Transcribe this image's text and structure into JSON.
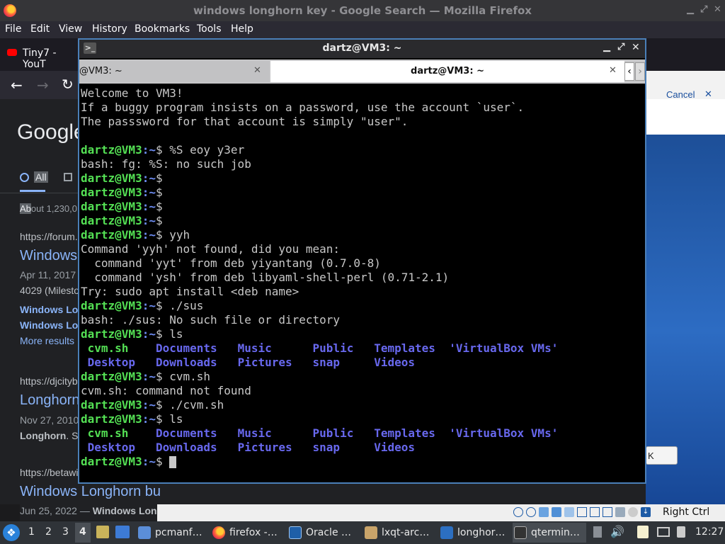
{
  "firefox": {
    "window_title": "windows longhorn key - Google Search — Mozilla Firefox",
    "menu": [
      "File",
      "Edit",
      "View",
      "History",
      "Bookmarks",
      "Tools",
      "Help"
    ],
    "tab_label": "Tiny7 - YouT",
    "google": {
      "logo": "Google",
      "tab_all": "All",
      "about_prefix": "Ab",
      "about_rest": "out 1,230,0",
      "results": [
        {
          "url": "https://forum.",
          "title": "Windows",
          "date": "Apr 11, 2017",
          "snippet": "4029 (Milesto",
          "sub1": "Windows Lo",
          "sub2": "Windows Lo",
          "more": "More results"
        },
        {
          "url": "https://djcityb",
          "title": "Longhorn",
          "date": "Nov 27, 2010",
          "snippet_bold": "Longhorn",
          "snippet": ". S"
        },
        {
          "url": "https://betawi",
          "title": "Windows Longhorn bu",
          "date": "Jun 25, 2022 —",
          "snippet_bold": "Windows Lon"
        }
      ],
      "cancel": "Cancel",
      "ok_frag": "K"
    }
  },
  "terminal": {
    "title": "dartz@VM3: ~",
    "tabs": [
      {
        "label": "@VM3: ~",
        "active": false
      },
      {
        "label": "dartz@VM3: ~",
        "active": true
      }
    ],
    "prompt_user": "dartz@VM3",
    "prompt_path": ":~",
    "prompt_sym": "$",
    "lines": [
      {
        "type": "text",
        "text": "Welcome to VM3!"
      },
      {
        "type": "text",
        "text": "If a buggy program insists on a password, use the account `user`."
      },
      {
        "type": "text",
        "text": "The passsword for that account is simply \"user\"."
      },
      {
        "type": "text",
        "text": ""
      },
      {
        "type": "prompt",
        "cmd": " %S eoy y3er"
      },
      {
        "type": "text",
        "text": "bash: fg: %S: no such job"
      },
      {
        "type": "prompt",
        "cmd": ""
      },
      {
        "type": "prompt",
        "cmd": ""
      },
      {
        "type": "prompt",
        "cmd": ""
      },
      {
        "type": "prompt",
        "cmd": ""
      },
      {
        "type": "prompt",
        "cmd": " yyh"
      },
      {
        "type": "text",
        "text": "Command 'yyh' not found, did you mean:"
      },
      {
        "type": "text",
        "text": "  command 'yyt' from deb yiyantang (0.7.0-8)"
      },
      {
        "type": "text",
        "text": "  command 'ysh' from deb libyaml-shell-perl (0.71-2.1)"
      },
      {
        "type": "text",
        "text": "Try: sudo apt install <deb name>"
      },
      {
        "type": "prompt",
        "cmd": " ./sus"
      },
      {
        "type": "text",
        "text": "bash: ./sus: No such file or directory"
      },
      {
        "type": "prompt",
        "cmd": " ls"
      },
      {
        "type": "ls",
        "items": [
          {
            "t": " cvm.sh    ",
            "c": "exe"
          },
          {
            "t": "Documents   ",
            "c": "dirc"
          },
          {
            "t": "Music      ",
            "c": "dirc"
          },
          {
            "t": "Public   ",
            "c": "dirc"
          },
          {
            "t": "Templates  ",
            "c": "dirc"
          },
          {
            "t": "'VirtualBox VMs'",
            "c": "dirc"
          }
        ]
      },
      {
        "type": "ls",
        "items": [
          {
            "t": " Desktop   ",
            "c": "dirc"
          },
          {
            "t": "Downloads   ",
            "c": "dirc"
          },
          {
            "t": "Pictures   ",
            "c": "dirc"
          },
          {
            "t": "snap     ",
            "c": "dirc"
          },
          {
            "t": "Videos",
            "c": "dirc"
          }
        ]
      },
      {
        "type": "prompt",
        "cmd": " cvm.sh"
      },
      {
        "type": "text",
        "text": "cvm.sh: command not found"
      },
      {
        "type": "prompt",
        "cmd": " ./cvm.sh"
      },
      {
        "type": "prompt",
        "cmd": " ls"
      },
      {
        "type": "ls",
        "items": [
          {
            "t": " cvm.sh    ",
            "c": "exe"
          },
          {
            "t": "Documents   ",
            "c": "dirc"
          },
          {
            "t": "Music      ",
            "c": "dirc"
          },
          {
            "t": "Public   ",
            "c": "dirc"
          },
          {
            "t": "Templates  ",
            "c": "dirc"
          },
          {
            "t": "'VirtualBox VMs'",
            "c": "dirc"
          }
        ]
      },
      {
        "type": "ls",
        "items": [
          {
            "t": " Desktop   ",
            "c": "dirc"
          },
          {
            "t": "Downloads   ",
            "c": "dirc"
          },
          {
            "t": "Pictures   ",
            "c": "dirc"
          },
          {
            "t": "snap     ",
            "c": "dirc"
          },
          {
            "t": "Videos",
            "c": "dirc"
          }
        ]
      },
      {
        "type": "prompt_cursor",
        "cmd": " "
      }
    ]
  },
  "vbox": {
    "host_key": "Right Ctrl"
  },
  "panel": {
    "desktops": [
      "1",
      "2",
      "3",
      "4"
    ],
    "active_desktop": "4",
    "tasks": [
      {
        "label": "pcmanf…",
        "icon": "folder-icon"
      },
      {
        "label": "firefox -…",
        "icon": "firefox-icon"
      },
      {
        "label": "Oracle …",
        "icon": "virtualbox-icon"
      },
      {
        "label": "lxqt-arc…",
        "icon": "archive-icon"
      },
      {
        "label": "longhor…",
        "icon": "vm-icon"
      },
      {
        "label": "qtermin…",
        "icon": "terminal-icon"
      }
    ],
    "clock": "12:27"
  }
}
